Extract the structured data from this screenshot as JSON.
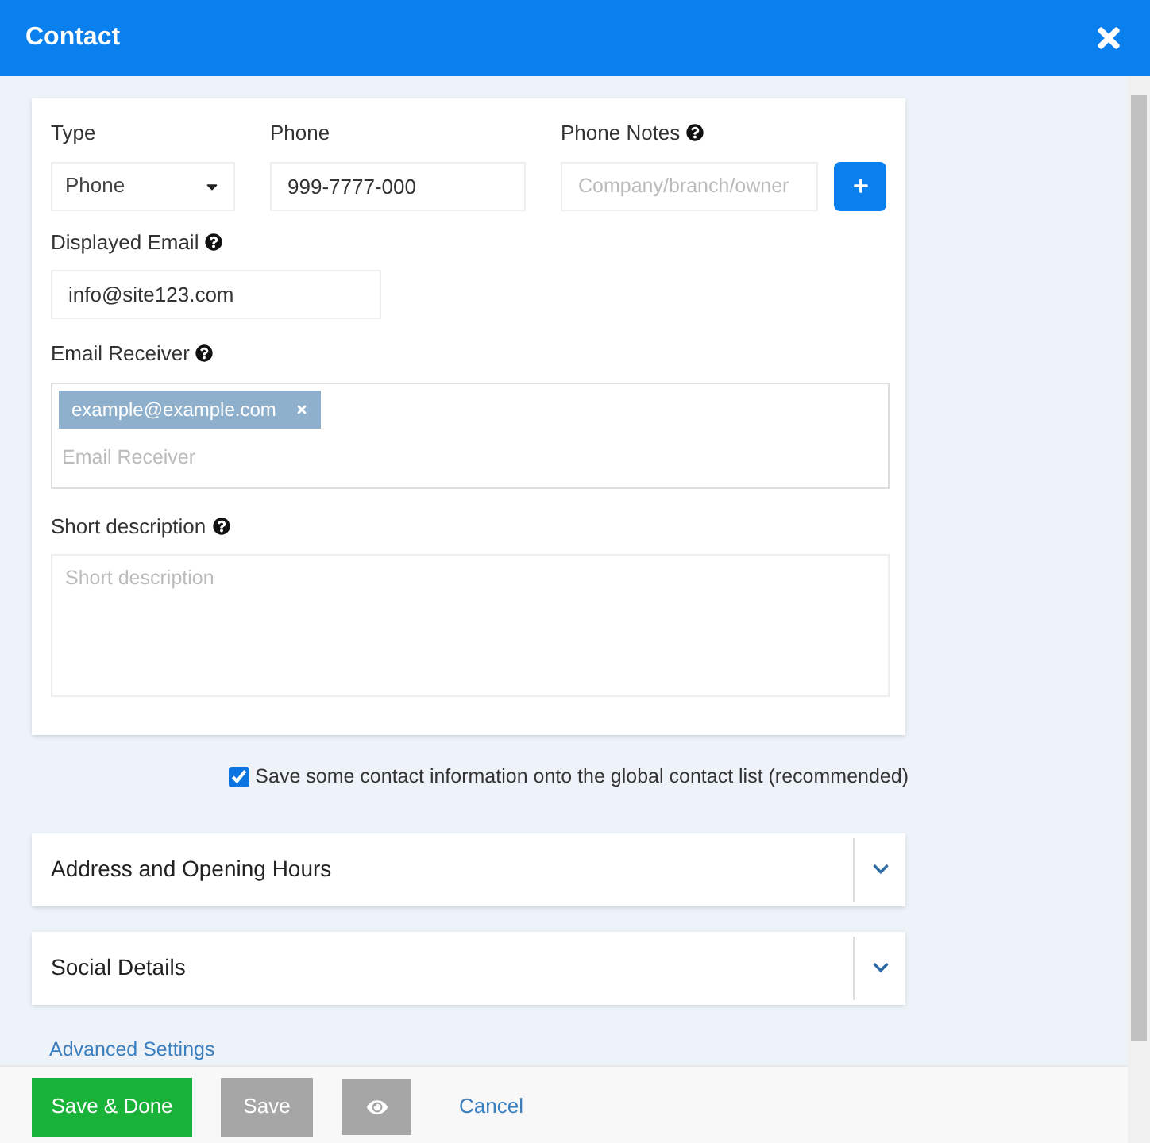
{
  "header": {
    "title": "Contact"
  },
  "form": {
    "type": {
      "label": "Type",
      "value": "Phone"
    },
    "phone": {
      "label": "Phone",
      "value": "999-7777-000"
    },
    "phone_notes": {
      "label": "Phone Notes",
      "placeholder": "Company/branch/owner",
      "help": true
    },
    "displayed_email": {
      "label": "Displayed Email",
      "value": "info@site123.com",
      "help": true
    },
    "email_receiver": {
      "label": "Email Receiver",
      "help": true,
      "tags": [
        "example@example.com"
      ],
      "placeholder": "Email Receiver"
    },
    "short_description": {
      "label": "Short description",
      "help": true,
      "placeholder": "Short description"
    }
  },
  "global_contact": {
    "label": "Save some contact information onto the global contact list (recommended)",
    "checked": true
  },
  "sections": [
    {
      "title": "Address and Opening Hours",
      "expanded": false
    },
    {
      "title": "Social Details",
      "expanded": false
    }
  ],
  "advanced_link": "Advanced Settings",
  "footer": {
    "save_done": "Save & Done",
    "save": "Save",
    "cancel": "Cancel"
  }
}
